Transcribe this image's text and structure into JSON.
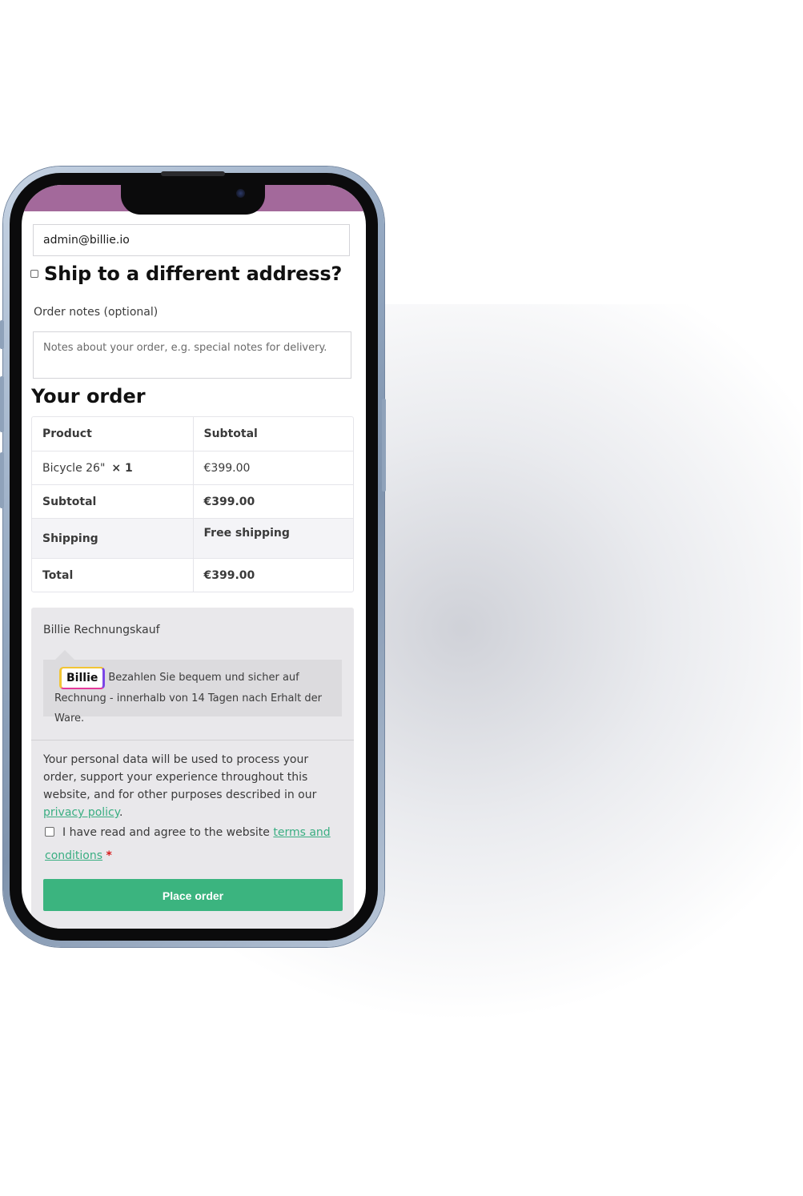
{
  "checkout": {
    "email_value": "admin@billie.io",
    "ship_different_label": "Ship to a different address?",
    "order_notes_label": "Order notes (optional)",
    "order_notes_placeholder": "Notes about your order, e.g. special notes for delivery.",
    "your_order_title": "Your order"
  },
  "order_table": {
    "header": {
      "product": "Product",
      "subtotal": "Subtotal"
    },
    "item": {
      "name": "Bicycle 26\"",
      "qty": "× 1",
      "price": "€399.00"
    },
    "subtotal": {
      "label": "Subtotal",
      "value": "€399.00"
    },
    "shipping": {
      "label": "Shipping",
      "value": "Free shipping"
    },
    "total": {
      "label": "Total",
      "value": "€399.00"
    }
  },
  "payment": {
    "method_label": "Billie Rechnungskauf",
    "logo_text": "Billie",
    "description": "Bezahlen Sie bequem und sicher auf Rechnung - innerhalb von 14 Tagen nach Erhalt der Ware.",
    "privacy_text_before": "Your personal data will be used to process your order, support your experience throughout this website, and for other purposes described in our ",
    "privacy_link": "privacy policy",
    "privacy_text_after": ".",
    "terms_text": "I have read and agree to the website ",
    "terms_link": "terms and conditions",
    "required_marker": "*",
    "place_order_label": "Place order"
  },
  "colors": {
    "status_bar": "#a3699b",
    "button": "#3bb47f",
    "link": "#3aae82"
  }
}
